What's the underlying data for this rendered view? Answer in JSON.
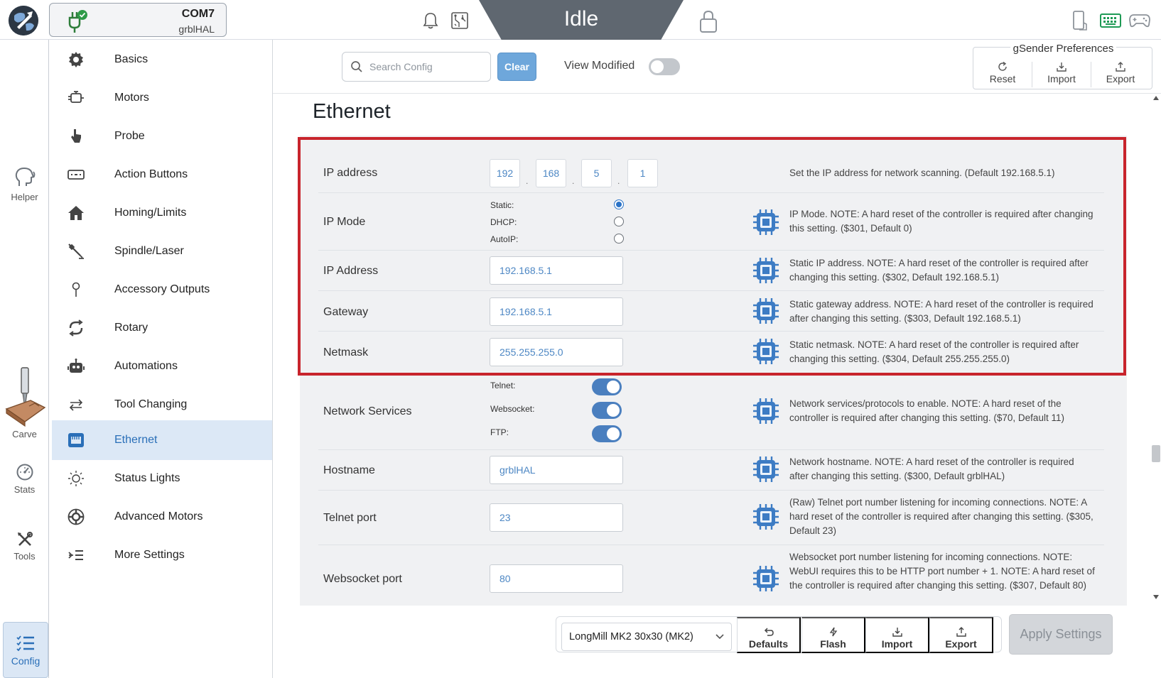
{
  "topbar": {
    "port": "COM7",
    "firmware": "grblHAL",
    "state": "Idle"
  },
  "rail": {
    "helper": "Helper",
    "carve": "Carve",
    "stats": "Stats",
    "tools": "Tools",
    "config": "Config"
  },
  "nav": {
    "items": [
      {
        "label": "Basics",
        "icon": "gear-icon"
      },
      {
        "label": "Motors",
        "icon": "motor-icon"
      },
      {
        "label": "Probe",
        "icon": "probe-icon"
      },
      {
        "label": "Action Buttons",
        "icon": "keyboard-icon"
      },
      {
        "label": "Homing/Limits",
        "icon": "home-icon"
      },
      {
        "label": "Spindle/Laser",
        "icon": "spindle-icon"
      },
      {
        "label": "Accessory Outputs",
        "icon": "pin-icon"
      },
      {
        "label": "Rotary",
        "icon": "rotary-icon"
      },
      {
        "label": "Automations",
        "icon": "robot-icon"
      },
      {
        "label": "Tool Changing",
        "icon": "swap-icon"
      },
      {
        "label": "Ethernet",
        "icon": "ethernet-icon",
        "active": true
      },
      {
        "label": "Status Lights",
        "icon": "light-icon"
      },
      {
        "label": "Advanced Motors",
        "icon": "cog-icon"
      },
      {
        "label": "More Settings",
        "icon": "list-indent-icon"
      }
    ]
  },
  "header": {
    "search_placeholder": "Search Config",
    "clear_label": "Clear",
    "view_modified_label": "View Modified",
    "view_modified_on": false,
    "prefs_title": "gSender Preferences",
    "prefs_reset": "Reset",
    "prefs_import": "Import",
    "prefs_export": "Export"
  },
  "section": {
    "title": "Ethernet",
    "ip_address": {
      "label": "IP address",
      "octets": [
        "192",
        "168",
        "5",
        "1"
      ],
      "dot": ".",
      "desc": "Set the IP address for network scanning. (Default 192.168.5.1)"
    },
    "ip_mode": {
      "label": "IP Mode",
      "options": [
        "Static:",
        "DHCP:",
        "AutoIP:"
      ],
      "selected": "Static:",
      "desc": "IP Mode. NOTE: A hard reset of the controller is required after changing this setting. ($301, Default 0)"
    },
    "static_ip": {
      "label": "IP Address",
      "value": "192.168.5.1",
      "desc": "Static IP address. NOTE: A hard reset of the controller is required after changing this setting. ($302, Default 192.168.5.1)"
    },
    "gateway": {
      "label": "Gateway",
      "value": "192.168.5.1",
      "desc": "Static gateway address. NOTE: A hard reset of the controller is required after changing this setting. ($303, Default 192.168.5.1)"
    },
    "netmask": {
      "label": "Netmask",
      "value": "255.255.255.0",
      "desc": "Static netmask. NOTE: A hard reset of the controller is required after changing this setting. ($304, Default 255.255.255.0)"
    },
    "network_services": {
      "label": "Network Services",
      "options": [
        "Telnet:",
        "Websocket:",
        "FTP:"
      ],
      "enabled": [
        true,
        true,
        true
      ],
      "desc": "Network services/protocols to enable. NOTE: A hard reset of the controller is required after changing this setting. ($70, Default 11)"
    },
    "hostname": {
      "label": "Hostname",
      "value": "grblHAL",
      "desc": "Network hostname. NOTE: A hard reset of the controller is required after changing this setting. ($300, Default grblHAL)"
    },
    "telnet_port": {
      "label": "Telnet port",
      "value": "23",
      "desc": "(Raw) Telnet port number listening for incoming connections. NOTE: A hard reset of the controller is required after changing this setting. ($305, Default 23)"
    },
    "websocket_port": {
      "label": "Websocket port",
      "value": "80",
      "desc": "Websocket port number listening for incoming connections. NOTE: WebUI requires this to be HTTP port number + 1. NOTE: A hard reset of the controller is required after changing this setting. ($307, Default 80)"
    }
  },
  "bottom": {
    "machine": "LongMill MK2 30x30 (MK2)",
    "defaults": "Defaults",
    "flash": "Flash",
    "import": "Import",
    "export": "Export",
    "apply": "Apply Settings"
  },
  "colors": {
    "accent": "#2a6fb8",
    "highlight_border": "#c8242c",
    "state_bg": "#5f6770",
    "toggle_on": "#4a7fbf",
    "chip_icon": "#3d7cc4"
  }
}
